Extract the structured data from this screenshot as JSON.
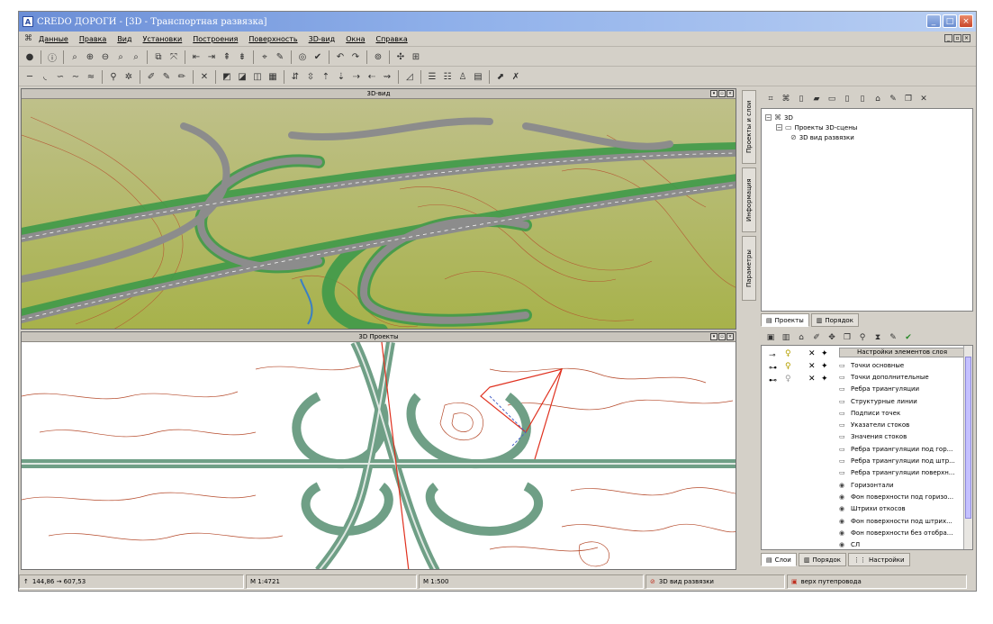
{
  "window": {
    "app_icon": "credo-icon",
    "title": "CREDO ДОРОГИ - [3D - Транспортная развязка]",
    "controls": [
      "minimize-icon",
      "maximize-icon",
      "close-icon"
    ]
  },
  "menu": {
    "items": [
      "Данные",
      "Правка",
      "Вид",
      "Установки",
      "Построения",
      "Поверхность",
      "3D-вид",
      "Окна",
      "Справка"
    ]
  },
  "panels": {
    "view3d_title": "3D-вид",
    "plan_title": "3D Проекты"
  },
  "side_tabs": [
    "Проекты и слои",
    "Информация",
    "Параметры"
  ],
  "project_tree": {
    "rows": [
      {
        "label": "3D",
        "level": 0
      },
      {
        "label": "Проекты 3D-сцены",
        "level": 1
      },
      {
        "label": "3D вид развязки",
        "level": 2
      }
    ]
  },
  "project_tabs": [
    "Проекты",
    "Порядок"
  ],
  "layer_settings": {
    "header": "Настройки элементов слоя",
    "items": [
      "Точки основные",
      "Точки дополнительные",
      "Ребра триангуляции",
      "Структурные линии",
      "Подписи точек",
      "Указатели стоков",
      "Значения стоков",
      "Ребра триангуляции под гор...",
      "Ребра триангуляции под штр...",
      "Ребра триангуляции поверхн...",
      "Горизонтали",
      "Фон поверхности под горизо...",
      "Штрихи откосов",
      "Фон поверхности под штрих...",
      "Фон поверхности без отобра...",
      "СЛ"
    ]
  },
  "bottom_tabs": [
    "Слои",
    "Порядок",
    "Настройки"
  ],
  "status": {
    "coords": "144,86  →  607,53",
    "scale1": "М 1:4721",
    "scale2": "М 1:500",
    "layer": "3D вид развязки",
    "surface": "верх путепровода"
  },
  "colors": {
    "terrain": "#a7b24a",
    "road": "#8c8c8c",
    "slope": "#3f9a4a",
    "contour": "#b54a2b",
    "selection": "#e0301e",
    "title_bar": "#6b8ed6"
  }
}
